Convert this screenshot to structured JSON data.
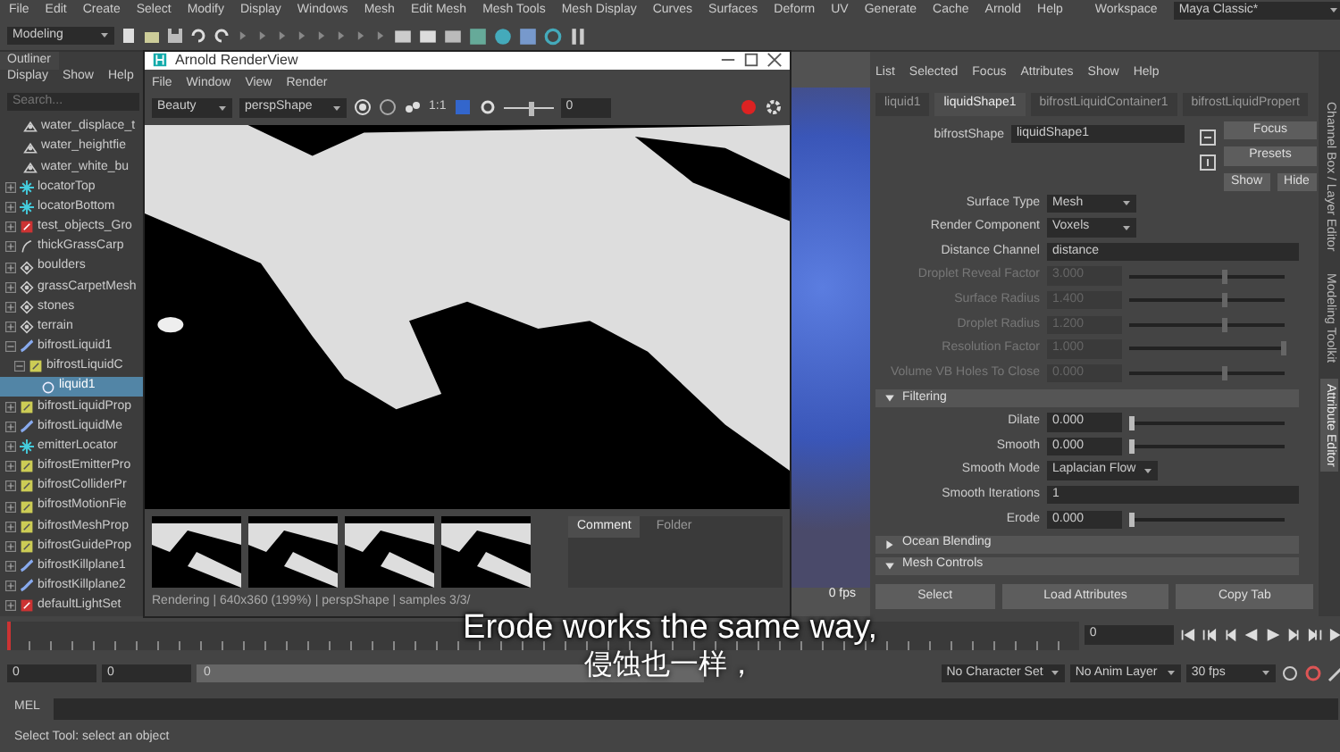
{
  "menu_bar": {
    "items": [
      "File",
      "Edit",
      "Create",
      "Select",
      "Modify",
      "Display",
      "Windows",
      "Mesh",
      "Edit Mesh",
      "Mesh Tools",
      "Mesh Display",
      "Curves",
      "Surfaces",
      "Deform",
      "UV",
      "Generate",
      "Cache",
      "Arnold",
      "Help"
    ],
    "workspace_label": "Workspace",
    "workspace": "Maya Classic*"
  },
  "toolbar": {
    "menu_set": "Modeling"
  },
  "outliner": {
    "title": "Outliner",
    "menu": [
      "Display",
      "Show",
      "Help"
    ],
    "search_placeholder": "Search...",
    "items": [
      {
        "label": "water_displace_t",
        "kind": "mesh",
        "selected": false
      },
      {
        "label": "water_heightfie",
        "kind": "mesh",
        "selected": false
      },
      {
        "label": "water_white_bu",
        "kind": "mesh",
        "selected": false
      },
      {
        "label": "locatorTop",
        "kind": "locator",
        "expanded": false,
        "selected": false
      },
      {
        "label": "locatorBottom",
        "kind": "locator",
        "expanded": false,
        "selected": false
      },
      {
        "label": "test_objects_Gro",
        "kind": "set",
        "expanded": false,
        "selected": false
      },
      {
        "label": "thickGrassCarp",
        "kind": "curve",
        "expanded": false,
        "selected": false
      },
      {
        "label": "boulders",
        "kind": "group",
        "expanded": false,
        "selected": false
      },
      {
        "label": "grassCarpetMesh",
        "kind": "group",
        "expanded": false,
        "selected": false
      },
      {
        "label": "stones",
        "kind": "group",
        "expanded": false,
        "selected": false
      },
      {
        "label": "terrain",
        "kind": "group",
        "expanded": false,
        "selected": false
      },
      {
        "label": "bifrostLiquid1",
        "kind": "liquid",
        "expanded": true,
        "selected": false,
        "children": [
          {
            "label": "bifrostLiquidC",
            "kind": "props",
            "expanded": true,
            "selected": false,
            "children": [
              {
                "label": "liquid1",
                "kind": "shape",
                "selected": true
              }
            ]
          }
        ]
      },
      {
        "label": "bifrostLiquidProp",
        "kind": "props",
        "expanded": false,
        "selected": false
      },
      {
        "label": "bifrostLiquidMe",
        "kind": "liquid",
        "expanded": false,
        "selected": false
      },
      {
        "label": "emitterLocator",
        "kind": "locator",
        "expanded": false,
        "selected": false
      },
      {
        "label": "bifrostEmitterPro",
        "kind": "props",
        "expanded": false,
        "selected": false
      },
      {
        "label": "bifrostColliderPr",
        "kind": "props",
        "expanded": false,
        "selected": false
      },
      {
        "label": "bifrostMotionFie",
        "kind": "props",
        "expanded": false,
        "selected": false
      },
      {
        "label": "bifrostMeshProp",
        "kind": "props",
        "expanded": false,
        "selected": false
      },
      {
        "label": "bifrostGuideProp",
        "kind": "props",
        "expanded": false,
        "selected": false
      },
      {
        "label": "bifrostKillplane1",
        "kind": "liquid",
        "expanded": false,
        "selected": false
      },
      {
        "label": "bifrostKillplane2",
        "kind": "liquid",
        "expanded": false,
        "selected": false
      },
      {
        "label": "defaultLightSet",
        "kind": "set",
        "expanded": false,
        "selected": false
      }
    ]
  },
  "render_view": {
    "title": "Arnold RenderView",
    "menu": [
      "File",
      "Window",
      "View",
      "Render"
    ],
    "aov": "Beauty",
    "camera": "perspShape",
    "ratio": "1:1",
    "exposure_slider": {
      "level": 0.5
    },
    "exposure": "0",
    "tabs": [
      {
        "label": "Comment",
        "selected": true
      },
      {
        "label": "Folder",
        "selected": false
      }
    ],
    "status": "Rendering | 640x360 (199%) | perspShape | samples 3/3/"
  },
  "viewport": {
    "fps": "0 fps"
  },
  "attribute_editor": {
    "menu": [
      "List",
      "Selected",
      "Focus",
      "Attributes",
      "Show",
      "Help"
    ],
    "tabs": [
      {
        "label": "liquid1",
        "selected": false
      },
      {
        "label": "liquidShape1",
        "selected": true
      },
      {
        "label": "bifrostLiquidContainer1",
        "selected": false
      },
      {
        "label": "bifrostLiquidPropert",
        "selected": false
      }
    ],
    "shape_label": "bifrostShape",
    "shape_value": "liquidShape1",
    "buttons": [
      "Focus",
      "Presets",
      "Show",
      "Hide"
    ],
    "rows": [
      {
        "label": "Surface Type",
        "kind": "dropdown",
        "value": "Mesh",
        "disabled": false
      },
      {
        "label": "Render Component",
        "kind": "dropdown",
        "value": "Voxels",
        "disabled": false
      },
      {
        "label": "Distance Channel",
        "kind": "text",
        "value": "distance",
        "disabled": false
      },
      {
        "label": "Droplet Reveal Factor",
        "kind": "slider",
        "value": "3.000",
        "level": 0.6,
        "disabled": true
      },
      {
        "label": "Surface Radius",
        "kind": "slider",
        "value": "1.400",
        "level": 0.6,
        "disabled": true
      },
      {
        "label": "Droplet Radius",
        "kind": "slider",
        "value": "1.200",
        "level": 0.6,
        "disabled": true
      },
      {
        "label": "Resolution Factor",
        "kind": "slider",
        "value": "1.000",
        "level": 0.98,
        "disabled": true
      },
      {
        "label": "Volume VB Holes To Close",
        "kind": "slider",
        "value": "0.000",
        "level": 0.6,
        "disabled": true
      }
    ],
    "sections": [
      {
        "title": "Filtering",
        "expanded": true,
        "rows": [
          {
            "label": "Dilate",
            "kind": "slider",
            "value": "0.000",
            "level": 0,
            "disabled": false
          },
          {
            "label": "Smooth",
            "kind": "slider",
            "value": "0.000",
            "level": 0,
            "disabled": false
          },
          {
            "label": "Smooth Mode",
            "kind": "dropdown",
            "value": "Laplacian Flow",
            "disabled": false
          },
          {
            "label": "Smooth Iterations",
            "kind": "text",
            "value": "1",
            "disabled": false
          },
          {
            "label": "Erode",
            "kind": "slider",
            "value": "0.000",
            "level": 0,
            "disabled": false
          }
        ]
      },
      {
        "title": "Ocean Blending",
        "expanded": false
      },
      {
        "title": "Mesh Controls",
        "expanded": true
      }
    ],
    "bottom_buttons": [
      "Select",
      "Load Attributes",
      "Copy Tab"
    ]
  },
  "side_tabs": [
    {
      "label": "Channel Box / Layer Editor",
      "selected": false
    },
    {
      "label": "Modeling Toolkit",
      "selected": false
    },
    {
      "label": "Attribute Editor",
      "selected": true
    }
  ],
  "time_slider": {
    "current_frame": "0",
    "level": 0
  },
  "range_slider": {
    "level": 1,
    "start": "0",
    "playback_start": "0",
    "range_start": "0",
    "character_set": "No Character Set",
    "anim_layer": "No Anim Layer",
    "fps": "30 fps"
  },
  "command_line": {
    "label": "MEL"
  },
  "help_line": "Select Tool: select an object",
  "subtitles": [
    "Erode works the same way,",
    "侵蚀也一样，"
  ]
}
